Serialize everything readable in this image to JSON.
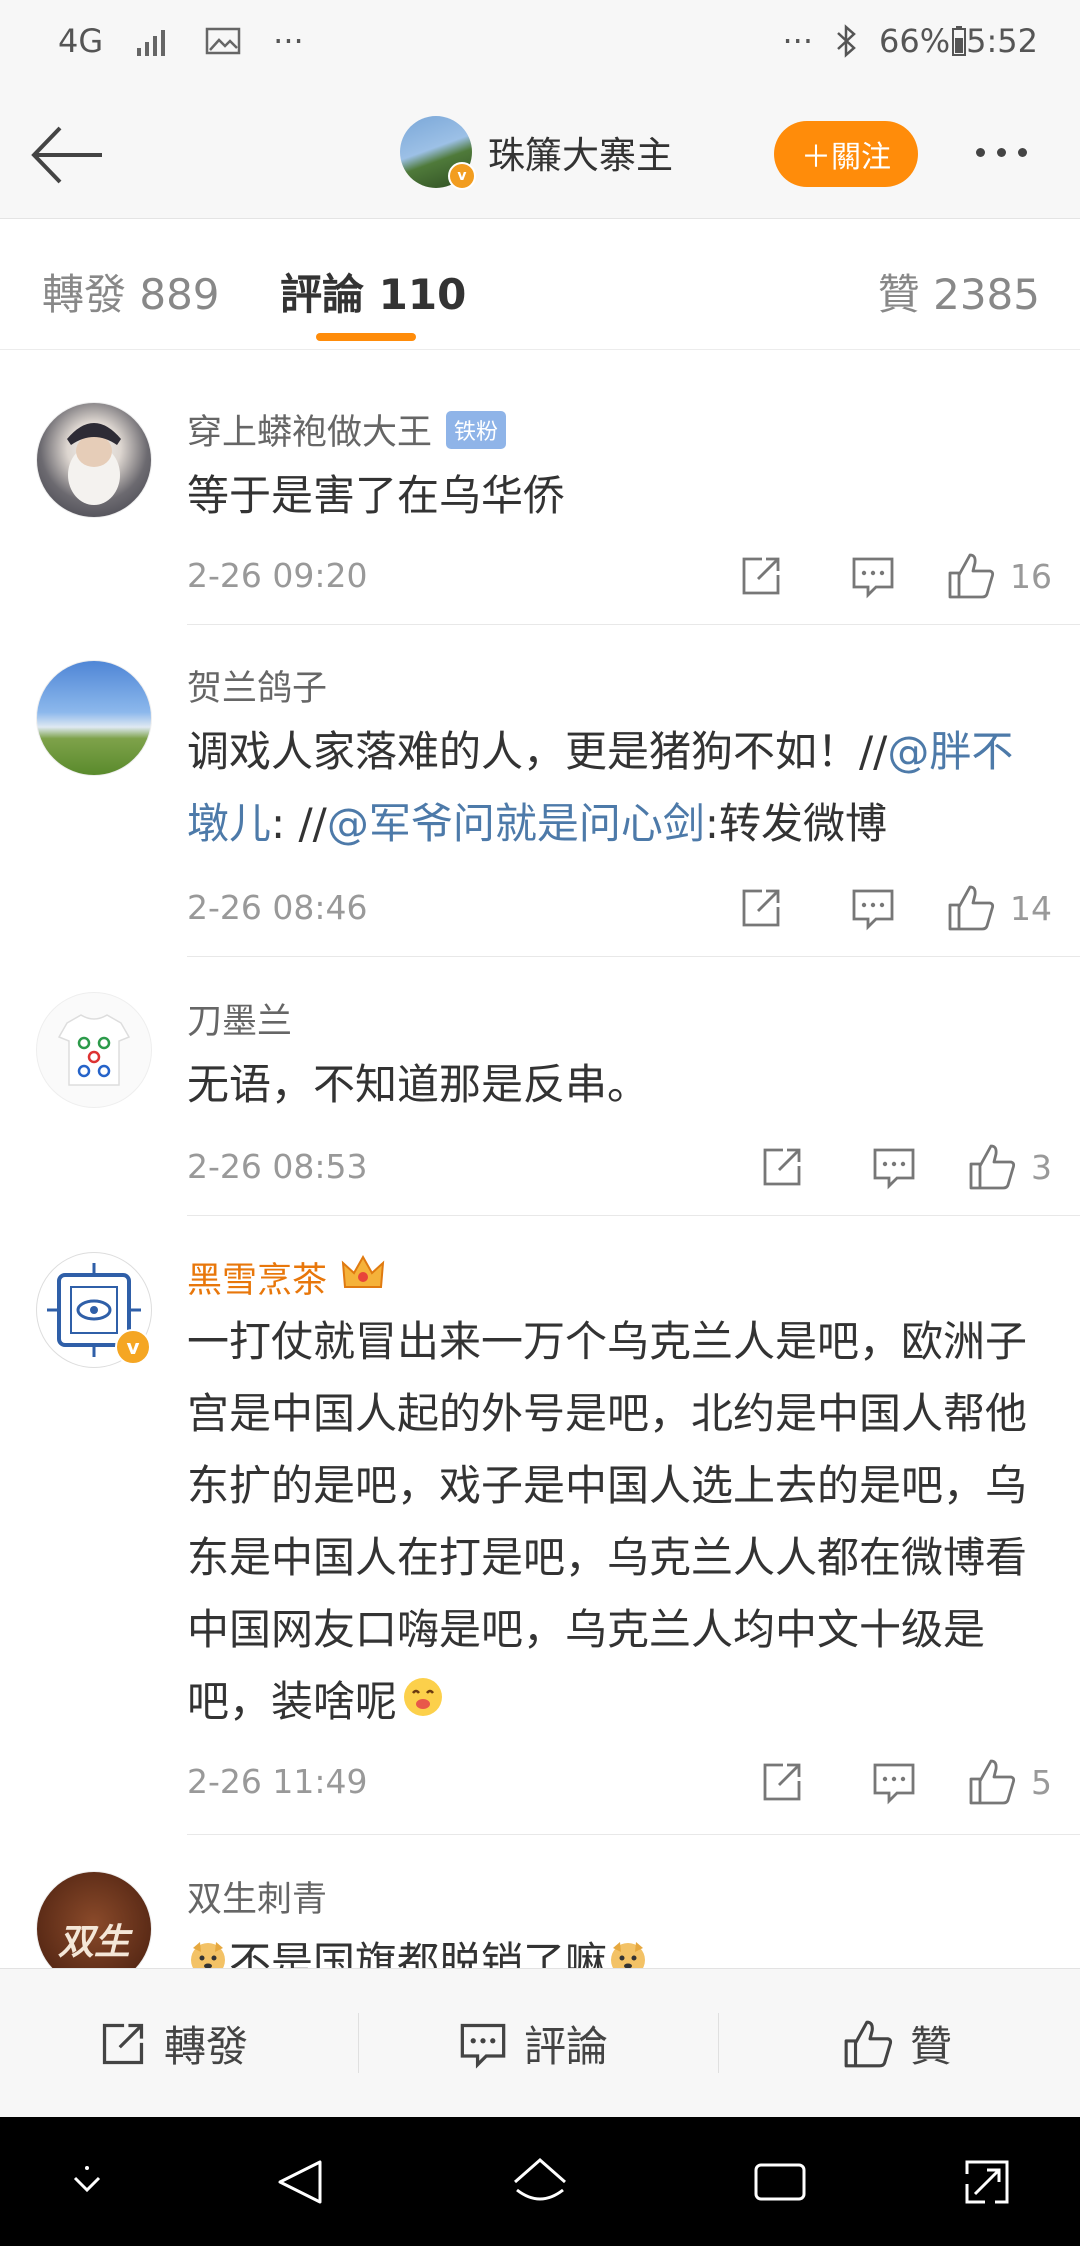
{
  "status_bar": {
    "network": "4G",
    "battery": "66%",
    "time": "5:52",
    "more_left": "···",
    "more_right": "···"
  },
  "header": {
    "user_name": "珠簾大寨主",
    "follow_label": "＋關注"
  },
  "tabs": [
    {
      "label": "轉發 889"
    },
    {
      "label": "評論 110"
    },
    {
      "label": "贊 2385"
    }
  ],
  "comments": [
    {
      "name": "穿上蟒袍做大王",
      "badge": "铁粉",
      "text": "等于是害了在乌华侨",
      "time": "2-26 09:20",
      "likes": "16"
    },
    {
      "name": "贺兰鸽子",
      "text_parts": [
        "调戏人家落难的人，更是猪狗不如！//",
        "@胖不墩儿",
        ": //",
        "@军爷问就是问心剑",
        ":转发微博"
      ],
      "time": "2-26 08:46",
      "likes": "14"
    },
    {
      "name": "刀墨兰",
      "text": "无语，不知道那是反串。",
      "time": "2-26 08:53",
      "likes": "3"
    },
    {
      "name": "黑雪烹茶",
      "text": "一打仗就冒出来一万个乌克兰人是吧，欧洲子宫是中国人起的外号是吧，北约是中国人帮他东扩的是吧，戏子是中国人选上去的是吧，乌东是中国人在打是吧，乌克兰人人都在微博看中国网友口嗨是吧，乌克兰人均中文十级是吧，装啥呢",
      "time": "2-26 11:49",
      "likes": "5"
    },
    {
      "name": "双生刺青",
      "text": "不是国旗都脱销了嘛"
    }
  ],
  "avatar_texts": {
    "shuangsheng": "双生"
  },
  "bottom_bar": {
    "repost": "轉發",
    "comment": "評論",
    "like": "贊"
  },
  "colors": {
    "accent": "#ff8c0a",
    "link": "#4d7aa9",
    "vip_name": "#e8770b"
  }
}
